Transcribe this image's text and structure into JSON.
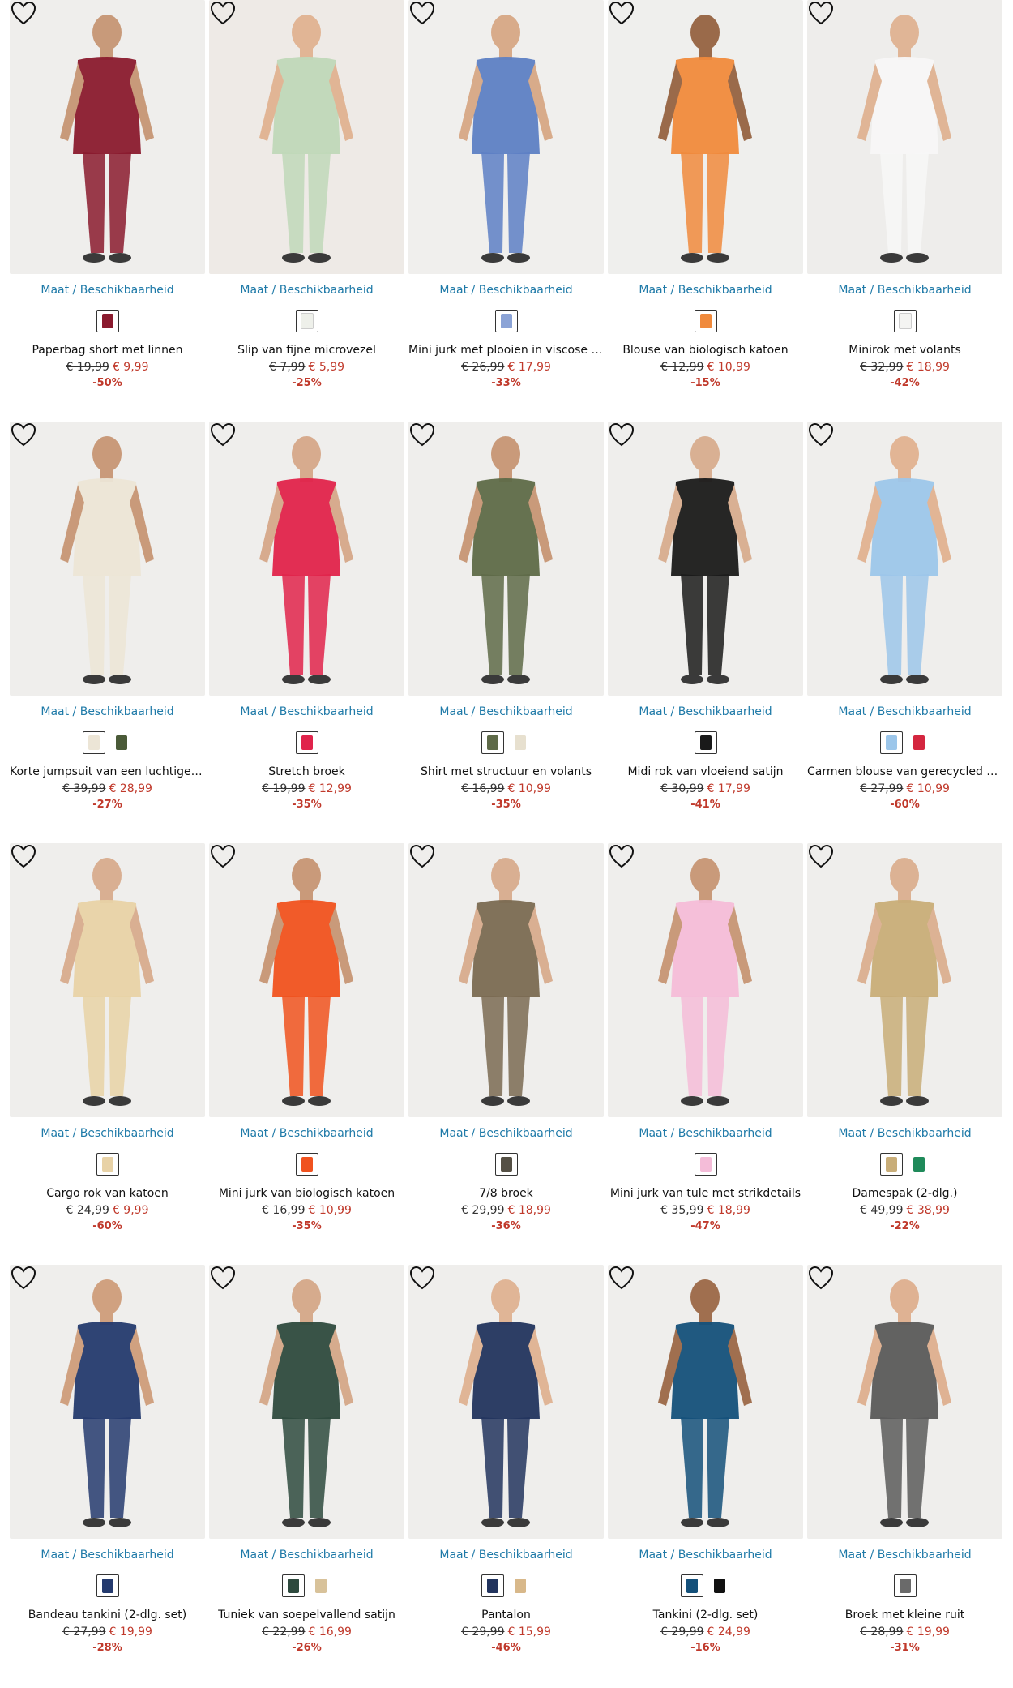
{
  "size_link_label": "Maat / Beschikbaarheid",
  "products": [
    {
      "name": "Paperbag short met linnen",
      "old_price": "€ 19,99",
      "new_price": "€ 9,99",
      "discount": "-50%",
      "bg": "#efeeec",
      "garment": "#8a1a2e",
      "skin": "#c89a7a",
      "swatches": [
        "#8a1a2e"
      ],
      "favorite_icon": "heart-outline-icon"
    },
    {
      "name": "Slip van fijne microvezel",
      "old_price": "€ 7,99",
      "new_price": "€ 5,99",
      "discount": "-25%",
      "bg": "#eeeae6",
      "garment": "#bfd8b8",
      "skin": "#e1b595",
      "swatches": [
        "#eef0ea"
      ],
      "favorite_icon": "heart-outline-icon"
    },
    {
      "name": "Mini jurk met plooien in viscose met Lenzing™ Ecovero™",
      "old_price": "€ 26,99",
      "new_price": "€ 17,99",
      "discount": "-33%",
      "bg": "#f0efed",
      "garment": "#5d7fc4",
      "skin": "#d8ab8a",
      "swatches": [
        "#8ba3d6"
      ],
      "favorite_icon": "heart-outline-icon"
    },
    {
      "name": "Blouse van biologisch katoen",
      "old_price": "€ 12,99",
      "new_price": "€ 10,99",
      "discount": "-15%",
      "bg": "#efefed",
      "garment": "#f08a3c",
      "skin": "#9a6a4a",
      "swatches": [
        "#f08a3c"
      ],
      "favorite_icon": "heart-outline-icon"
    },
    {
      "name": "Minirok met volants",
      "old_price": "€ 32,99",
      "new_price": "€ 18,99",
      "discount": "-42%",
      "bg": "#eeedeb",
      "garment": "#f7f7f7",
      "skin": "#e0b596",
      "swatches": [
        "#f4f4f2"
      ],
      "favorite_icon": "heart-outline-icon"
    },
    {
      "name": "Korte jumpsuit van een luchtige linnen-mix",
      "old_price": "€ 39,99",
      "new_price": "€ 28,99",
      "discount": "-27%",
      "bg": "#efeeec",
      "garment": "#ece5d6",
      "skin": "#c99a7a",
      "swatches": [
        "#ece5d6",
        "#4a5a38"
      ],
      "favorite_icon": "heart-outline-icon"
    },
    {
      "name": "Stretch broek",
      "old_price": "€ 19,99",
      "new_price": "€ 12,99",
      "discount": "-35%",
      "bg": "#efeeec",
      "garment": "#e0234b",
      "skin": "#d7ab8e",
      "swatches": [
        "#e0234b"
      ],
      "favorite_icon": "heart-outline-icon"
    },
    {
      "name": "Shirt met structuur en volants",
      "old_price": "€ 16,99",
      "new_price": "€ 10,99",
      "discount": "-35%",
      "bg": "#efeeec",
      "garment": "#5e6a48",
      "skin": "#c99a7a",
      "swatches": [
        "#5e6a48",
        "#e7e0cf"
      ],
      "favorite_icon": "heart-outline-icon"
    },
    {
      "name": "Midi rok van vloeiend satijn",
      "old_price": "€ 30,99",
      "new_price": "€ 17,99",
      "discount": "-41%",
      "bg": "#efeeec",
      "garment": "#1a1a1a",
      "skin": "#d9b093",
      "swatches": [
        "#1a1a1a"
      ],
      "favorite_icon": "heart-outline-icon"
    },
    {
      "name": "Carmen blouse van gerecycled polyester",
      "old_price": "€ 27,99",
      "new_price": "€ 10,99",
      "discount": "-60%",
      "bg": "#efeeec",
      "garment": "#9cc6ea",
      "skin": "#e2b595",
      "swatches": [
        "#9cc6ea",
        "#d4263f"
      ],
      "favorite_icon": "heart-outline-icon"
    },
    {
      "name": "Cargo rok van katoen",
      "old_price": "€ 24,99",
      "new_price": "€ 9,99",
      "discount": "-60%",
      "bg": "#efeeec",
      "garment": "#e8d2a6",
      "skin": "#d9af92",
      "swatches": [
        "#e8d2a6"
      ],
      "favorite_icon": "heart-outline-icon"
    },
    {
      "name": "Mini jurk van biologisch katoen",
      "old_price": "€ 16,99",
      "new_price": "€ 10,99",
      "discount": "-35%",
      "bg": "#efeeec",
      "garment": "#f0521f",
      "skin": "#c99a7a",
      "swatches": [
        "#f0521f"
      ],
      "favorite_icon": "heart-outline-icon"
    },
    {
      "name": "7/8 broek",
      "old_price": "€ 29,99",
      "new_price": "€ 18,99",
      "discount": "-36%",
      "bg": "#efeeec",
      "garment": "#7a6a52",
      "skin": "#d9af92",
      "swatches": [
        "#555045"
      ],
      "favorite_icon": "heart-outline-icon"
    },
    {
      "name": "Mini jurk van tule met strikdetails",
      "old_price": "€ 35,99",
      "new_price": "€ 18,99",
      "discount": "-47%",
      "bg": "#efeeec",
      "garment": "#f4bcd8",
      "skin": "#c99a7a",
      "swatches": [
        "#f4bcd8"
      ],
      "favorite_icon": "heart-outline-icon"
    },
    {
      "name": "Damespak (2-dlg.)",
      "old_price": "€ 49,99",
      "new_price": "€ 38,99",
      "discount": "-22%",
      "bg": "#efeeec",
      "garment": "#c8ad78",
      "skin": "#dcb294",
      "swatches": [
        "#c8ad78",
        "#1f8a5a"
      ],
      "favorite_icon": "heart-outline-icon"
    },
    {
      "name": "Bandeau tankini (2-dlg. set)",
      "old_price": "€ 27,99",
      "new_price": "€ 19,99",
      "discount": "-28%",
      "bg": "#efeeec",
      "garment": "#243a6e",
      "skin": "#d0a180",
      "swatches": [
        "#243a6e"
      ],
      "favorite_icon": "heart-outline-icon"
    },
    {
      "name": "Tuniek van soepelvallend satijn",
      "old_price": "€ 22,99",
      "new_price": "€ 16,99",
      "discount": "-26%",
      "bg": "#efeeec",
      "garment": "#2e4a3e",
      "skin": "#d6ab8d",
      "swatches": [
        "#2e4a3e",
        "#d8c29a"
      ],
      "favorite_icon": "heart-outline-icon"
    },
    {
      "name": "Pantalon",
      "old_price": "€ 29,99",
      "new_price": "€ 15,99",
      "discount": "-46%",
      "bg": "#efeeec",
      "garment": "#22345e",
      "skin": "#e0b596",
      "swatches": [
        "#22345e",
        "#d8b88a"
      ],
      "favorite_icon": "heart-outline-icon"
    },
    {
      "name": "Tankini (2-dlg. set)",
      "old_price": "€ 29,99",
      "new_price": "€ 24,99",
      "discount": "-16%",
      "bg": "#efeeec",
      "garment": "#14507a",
      "skin": "#a06f4f",
      "swatches": [
        "#14507a",
        "#111111"
      ],
      "favorite_icon": "heart-outline-icon"
    },
    {
      "name": "Broek met kleine ruit",
      "old_price": "€ 28,99",
      "new_price": "€ 19,99",
      "discount": "-31%",
      "bg": "#efeeec",
      "garment": "#5a5a5a",
      "skin": "#dfb293",
      "swatches": [
        "#6a6a6a"
      ],
      "favorite_icon": "heart-outline-icon"
    }
  ]
}
